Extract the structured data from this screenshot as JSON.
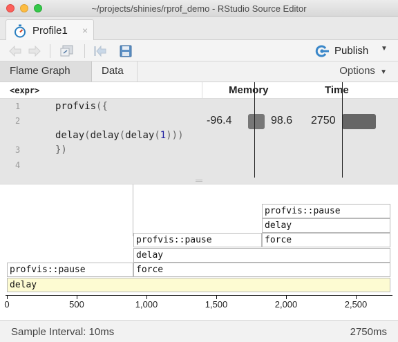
{
  "window": {
    "title": "~/projects/shinies/rprof_demo - RStudio Source Editor"
  },
  "tabs": [
    {
      "label": "Profile1",
      "close": "×"
    }
  ],
  "toolbar": {
    "publish_label": "Publish"
  },
  "views": {
    "flame_graph": "Flame Graph",
    "data": "Data",
    "options": "Options"
  },
  "code_header": {
    "expr": "<expr>",
    "memory": "Memory",
    "time": "Time"
  },
  "code": {
    "line_numbers": [
      "1",
      "2",
      "3",
      "4"
    ],
    "memory_dealloc": "-96.4",
    "memory_alloc": "98.6",
    "time_ms": "2750"
  },
  "flame": {
    "frames": [
      "delay",
      "profvis::pause",
      "force",
      "delay",
      "profvis::pause",
      "force",
      "delay",
      "profvis::pause"
    ],
    "axis_ticks": [
      "0",
      "500",
      "1,000",
      "1,500",
      "2,000",
      "2,500"
    ]
  },
  "status": {
    "sample_interval": "Sample Interval: 10ms",
    "total": "2750ms"
  },
  "colors": {
    "root_frame": "#fdfbd2",
    "bar": "#666666",
    "accent": "#2a7fc0"
  }
}
